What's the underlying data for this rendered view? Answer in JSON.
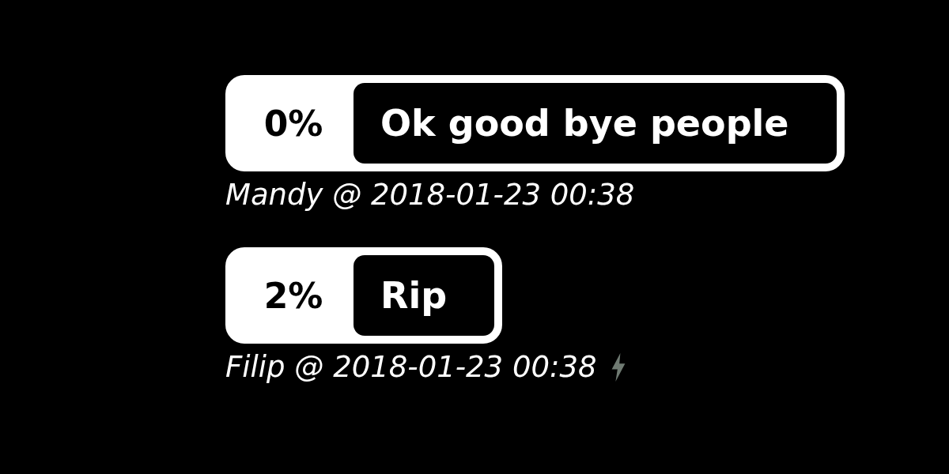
{
  "messages": [
    {
      "percent": "0%",
      "text": "Ok good bye people",
      "author": "Mandy @ 2018-01-23 00:38",
      "bolt": false
    },
    {
      "percent": "2%",
      "text": "Rip",
      "author": "Filip @ 2018-01-23 00:38",
      "bolt": true
    }
  ]
}
